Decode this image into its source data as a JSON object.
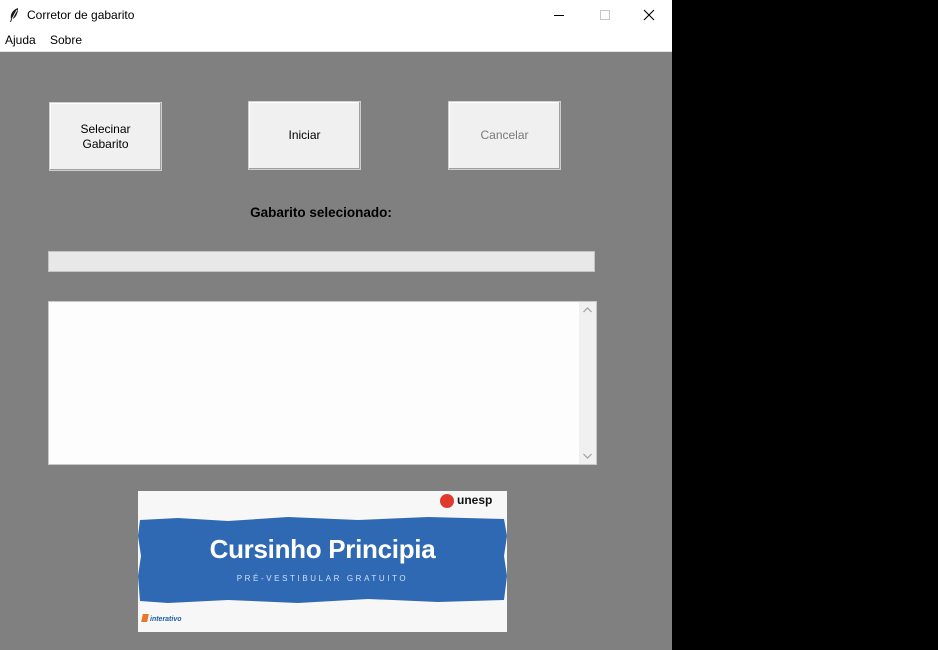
{
  "window": {
    "title": "Corretor de gabarito",
    "icon": "feather-icon"
  },
  "menu": {
    "items": [
      "Ajuda",
      "Sobre"
    ]
  },
  "buttons": {
    "select": "Selecinar Gabarito",
    "start": "Iniciar",
    "cancel": "Cancelar"
  },
  "selected_label": "Gabarito selecionado:",
  "selected_file_value": "",
  "log_text": "",
  "banner": {
    "title": "Cursinho Principia",
    "subtitle": "PRÉ-VESTIBULAR GRATUITO",
    "partner_logo_text": "unesp",
    "footer_logo_text": "interativo",
    "band_color": "#2f69b3"
  },
  "colors": {
    "window_bg": "#808080",
    "button_bg": "#f0f0f0",
    "disabled_text": "#7a7a7a"
  }
}
